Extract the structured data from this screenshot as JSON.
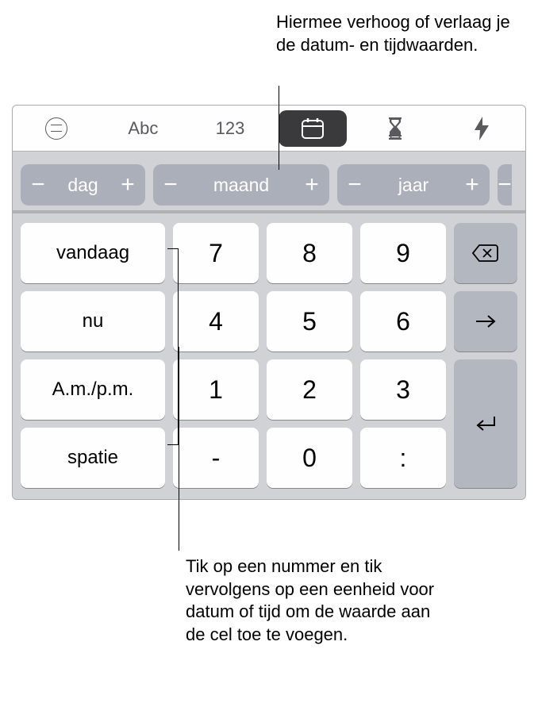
{
  "callouts": {
    "top": "Hiermee verhoog of verlaag je de datum- en tijdwaarden.",
    "bottom": "Tik op een nummer en tik vervolgens op een eenheid voor datum of tijd om de waarde aan de cel toe te voegen."
  },
  "toolbar": {
    "abc": "Abc",
    "num": "123"
  },
  "units": {
    "day": "dag",
    "month": "maand",
    "year": "jaar",
    "minus": "−",
    "plus": "+"
  },
  "presets": {
    "today": "vandaag",
    "now": "nu",
    "ampm": "A.m./p.m.",
    "space": "spatie"
  },
  "keypad": {
    "k7": "7",
    "k8": "8",
    "k9": "9",
    "k4": "4",
    "k5": "5",
    "k6": "6",
    "k1": "1",
    "k2": "2",
    "k3": "3",
    "dash": "-",
    "k0": "0",
    "colon": ":"
  }
}
